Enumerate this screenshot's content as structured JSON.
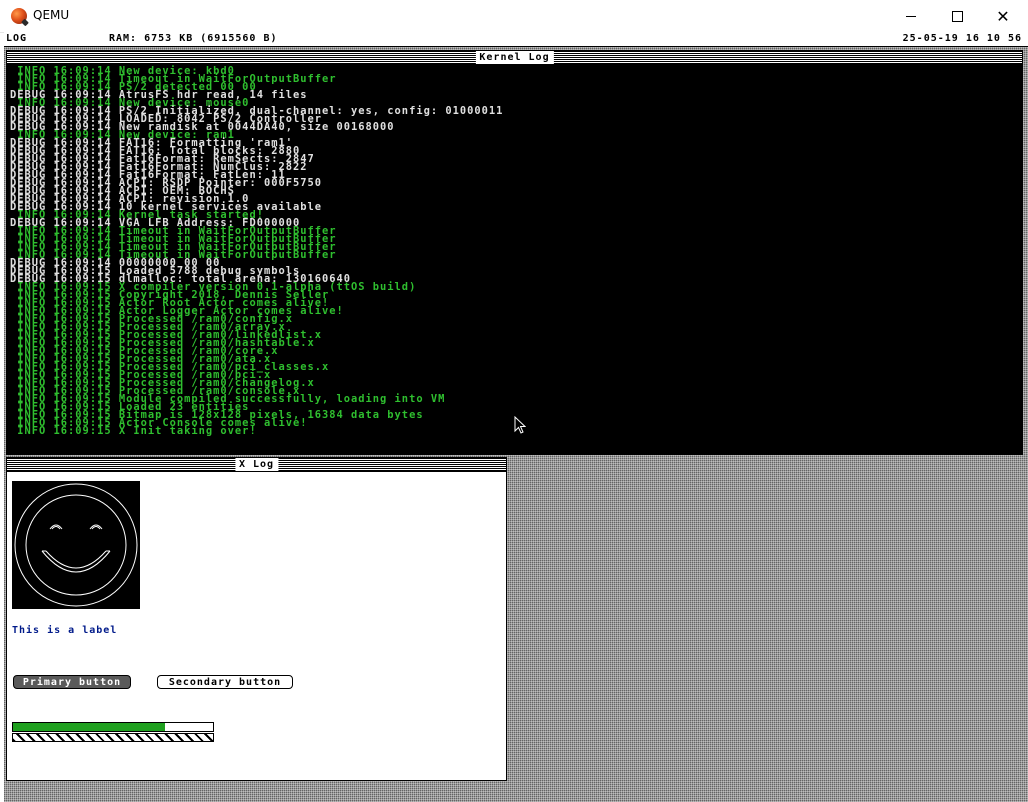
{
  "window": {
    "title": "QEMU"
  },
  "status_bar": {
    "mode": "LOG",
    "ram": "RAM: 6753 KB (6915560 B)",
    "datetime": "25-05-19 16 10 56"
  },
  "kernel_log": {
    "title": "Kernel Log",
    "lines": [
      {
        "level": "info",
        "text": " INFO 16:09:14 New device: kbd0"
      },
      {
        "level": "info",
        "text": " INFO 16:09:14 Timeout in WaitForOutputBuffer"
      },
      {
        "level": "info",
        "text": " INFO 16:09:14 PS/2 detected 00 00"
      },
      {
        "level": "debug",
        "text": "DEBUG 16:09:14 AtrusFS hdr read, 14 files"
      },
      {
        "level": "info",
        "text": " INFO 16:09:14 New device: mouse0"
      },
      {
        "level": "debug",
        "text": "DEBUG 16:09:14 PS/2 Initialized, dual-channel: yes, config: 01000011"
      },
      {
        "level": "debug",
        "text": "DEBUG 16:09:14 LOADED: 8042 PS/2 Controller"
      },
      {
        "level": "debug",
        "text": "DEBUG 16:09:14 New ramdisk at 0044DA40, size 00168000"
      },
      {
        "level": "info",
        "text": " INFO 16:09:14 New device: ram1"
      },
      {
        "level": "debug",
        "text": "DEBUG 16:09:14 FAT16: Formatting 'ram1'"
      },
      {
        "level": "debug",
        "text": "DEBUG 16:09:14 FAT16: Total blocks: 2880"
      },
      {
        "level": "debug",
        "text": "DEBUG 16:09:14 Fat16Format: RemSects: 2847"
      },
      {
        "level": "debug",
        "text": "DEBUG 16:09:14 Fat16Format: NumClus: 2822"
      },
      {
        "level": "debug",
        "text": "DEBUG 16:09:14 Fat16Format: FatLen: 11"
      },
      {
        "level": "debug",
        "text": "DEBUG 16:09:14 ACPI: RSDP Pointer: 000F5750"
      },
      {
        "level": "debug",
        "text": "DEBUG 16:09:14 ACPI: OEM: BOCHS"
      },
      {
        "level": "debug",
        "text": "DEBUG 16:09:14 ACPI: revision 1.0"
      },
      {
        "level": "debug",
        "text": "DEBUG 16:09:14 10 kernel services available"
      },
      {
        "level": "info",
        "text": " INFO 16:09:14 Kernel task started!"
      },
      {
        "level": "debug",
        "text": "DEBUG 16:09:14 VGA LFB Address: FD000000"
      },
      {
        "level": "info",
        "text": " INFO 16:09:14 Timeout in WaitForOutputBuffer"
      },
      {
        "level": "info",
        "text": " INFO 16:09:14 Timeout in WaitForOutputBuffer"
      },
      {
        "level": "info",
        "text": " INFO 16:09:14 Timeout in WaitForOutputBuffer"
      },
      {
        "level": "info",
        "text": " INFO 16:09:14 Timeout in WaitForOutputBuffer"
      },
      {
        "level": "debug",
        "text": "DEBUG 16:09:14 00000000 00 00"
      },
      {
        "level": "debug",
        "text": "DEBUG 16:09:15 Loaded 5788 debug symbols"
      },
      {
        "level": "debug",
        "text": "DEBUG 16:09:15 dlmalloc: total arena: 130160640"
      },
      {
        "level": "info",
        "text": " INFO 16:09:15 X compiler version 0.1-alpha (ttOS build)"
      },
      {
        "level": "info",
        "text": " INFO 16:09:15 Copyright 2018, Dennis Seller"
      },
      {
        "level": "info",
        "text": " INFO 16:09:15 Actor Root Actor comes alive!"
      },
      {
        "level": "info",
        "text": " INFO 16:09:15 Actor Logger Actor comes alive!"
      },
      {
        "level": "info",
        "text": " INFO 16:09:15 Processed /ram0/config.x"
      },
      {
        "level": "info",
        "text": " INFO 16:09:15 Processed /ram0/array.x"
      },
      {
        "level": "info",
        "text": " INFO 16:09:15 Processed /ram0/linkedlist.x"
      },
      {
        "level": "info",
        "text": " INFO 16:09:15 Processed /ram0/hashtable.x"
      },
      {
        "level": "info",
        "text": " INFO 16:09:15 Processed /ram0/core.x"
      },
      {
        "level": "info",
        "text": " INFO 16:09:15 Processed /ram0/ata.x"
      },
      {
        "level": "info",
        "text": " INFO 16:09:15 Processed /ram0/pci_classes.x"
      },
      {
        "level": "info",
        "text": " INFO 16:09:15 Processed /ram0/pci.x"
      },
      {
        "level": "info",
        "text": " INFO 16:09:15 Processed /ram0/changelog.x"
      },
      {
        "level": "info",
        "text": " INFO 16:09:15 Processed /ram0/console.x"
      },
      {
        "level": "info",
        "text": " INFO 16:09:15 Module compiled successfully, loading into VM"
      },
      {
        "level": "info",
        "text": " INFO 16:09:15 Loaded 23 entities"
      },
      {
        "level": "info",
        "text": " INFO 16:09:15 Bitmap is 128x128 pixels, 16384 data bytes"
      },
      {
        "level": "info",
        "text": " INFO 16:09:15 Actor Console comes alive!"
      },
      {
        "level": "info",
        "text": " INFO 16:09:15 X Init taking over!"
      }
    ]
  },
  "x_log": {
    "title": "X Log",
    "label": "This is a label",
    "primary_button": "Primary button",
    "secondary_button": "Secondary button",
    "progress_fraction": 0.76,
    "colors": {
      "progress": "#1fa01f",
      "label": "#001a8a",
      "info_text": "#2fbf2f",
      "debug_text": "#e0e0e0"
    }
  }
}
